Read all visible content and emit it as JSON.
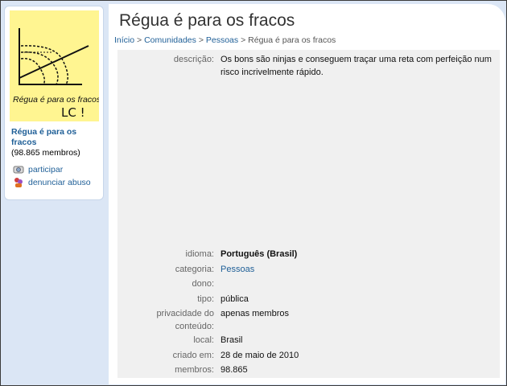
{
  "title": "Régua é para os fracos",
  "breadcrumb": {
    "items": [
      "Início",
      "Comunidades",
      "Pessoas"
    ],
    "current": "Régua é para os fracos",
    "separator": ">"
  },
  "sidebar": {
    "logo_text_line1": "Régua é para os fracos",
    "logo_text_line2": "LC !",
    "community_name": "Régua é para os fracos",
    "member_count": "(98.865 membros)",
    "actions": [
      {
        "label": "participar",
        "icon": "join-icon"
      },
      {
        "label": "denunciar abuso",
        "icon": "report-abuse-icon"
      }
    ]
  },
  "details": {
    "descricao_label": "descrição:",
    "descricao_value": "Os bons são ninjas e conseguem traçar uma reta com perfeição num risco incrivelmente rápido.",
    "idioma_label": "idioma:",
    "idioma_value": "Português (Brasil)",
    "categoria_label": "categoria:",
    "categoria_value": "Pessoas",
    "dono_label": "dono:",
    "dono_value": "",
    "tipo_label": "tipo:",
    "tipo_value": "pública",
    "privacidade_label": "privacidade do conteúdo:",
    "privacidade_value": "apenas membros",
    "local_label": "local:",
    "local_value": "Brasil",
    "criado_label": "criado em:",
    "criado_value": "28 de maio de 2010",
    "membros_label": "membros:",
    "membros_value": "98.865"
  }
}
